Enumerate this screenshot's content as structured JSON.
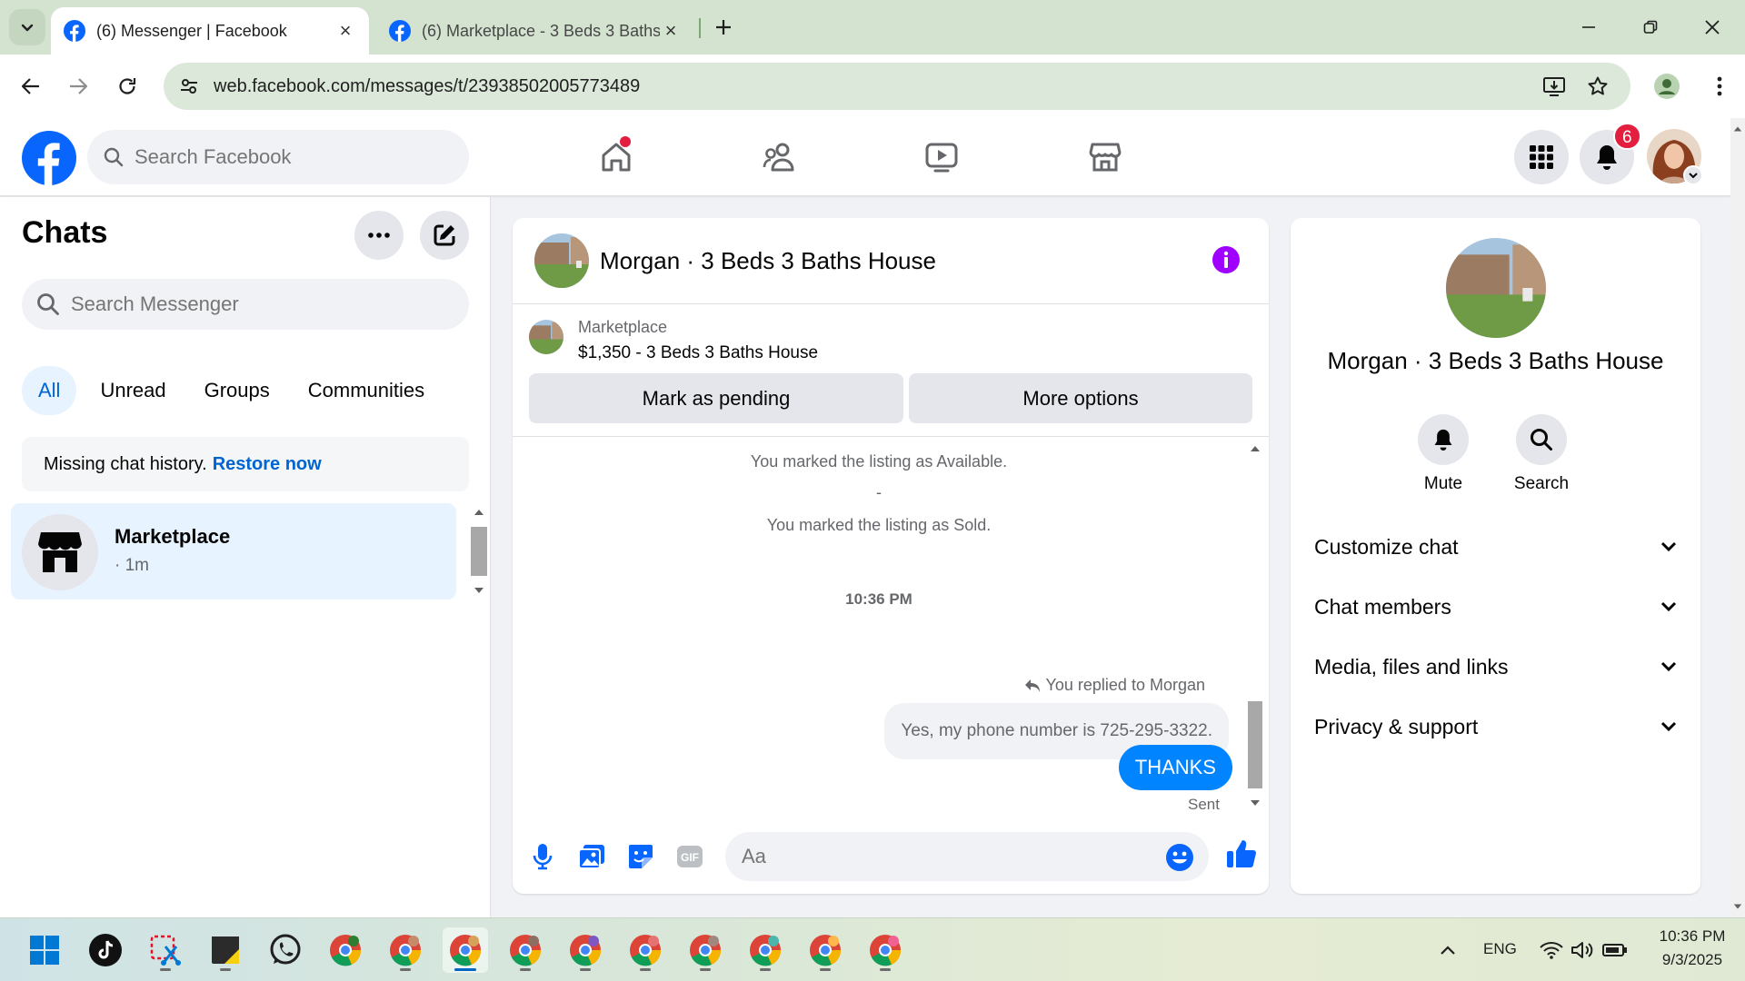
{
  "browser": {
    "tabs": [
      {
        "title": "(6) Messenger | Facebook",
        "active": true
      },
      {
        "title": "(6) Marketplace - 3 Beds 3 Baths House",
        "active": false
      }
    ],
    "url": "web.facebook.com/messages/t/23938502005773489"
  },
  "fb_header": {
    "search_placeholder": "Search Facebook",
    "notification_count": "6",
    "brand_color": "#0866ff"
  },
  "left_panel": {
    "title": "Chats",
    "search_placeholder": "Search Messenger",
    "filters": [
      "All",
      "Unread",
      "Groups",
      "Communities"
    ],
    "active_filter": "All",
    "missing_text": "Missing chat history.",
    "restore_link": "Restore now",
    "chats": [
      {
        "name": "Marketplace",
        "meta": "· 1m"
      }
    ]
  },
  "conversation": {
    "title": "Morgan · 3 Beds 3 Baths House",
    "listing_label": "Marketplace",
    "listing_title": "$1,350 - 3 Beds 3 Baths House",
    "mark_pending_label": "Mark as pending",
    "more_options_label": "More options",
    "system_messages": [
      "You marked the listing as Available.",
      "-",
      "You marked the listing as Sold."
    ],
    "timestamp": "10:36 PM",
    "reply_note": "You replied to Morgan",
    "quoted_message": "Yes, my phone number is 725-295-3322.",
    "sent_message": "THANKS",
    "sent_status": "Sent",
    "composer_placeholder": "Aa"
  },
  "info_panel": {
    "name": "Morgan · 3 Beds 3 Baths House",
    "actions": [
      "Mute",
      "Search"
    ],
    "sections": [
      "Customize chat",
      "Chat members",
      "Media, files and links",
      "Privacy & support"
    ]
  },
  "taskbar": {
    "language": "ENG",
    "time": "10:36 PM",
    "date": "9/3/2025"
  }
}
